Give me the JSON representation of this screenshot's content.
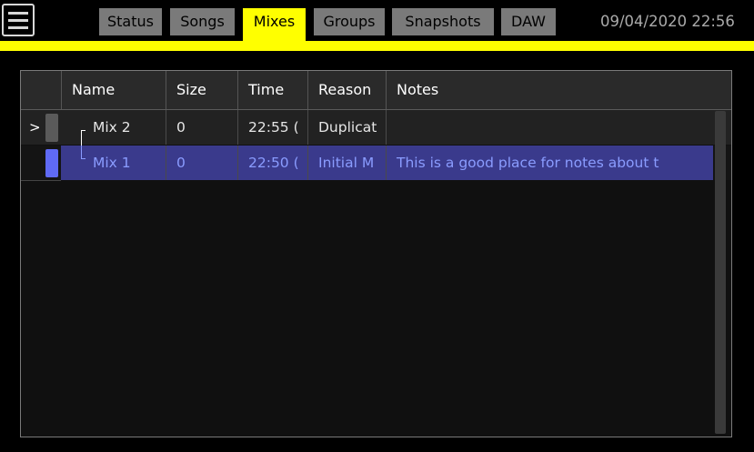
{
  "tabs": [
    {
      "label": "Status"
    },
    {
      "label": "Songs"
    },
    {
      "label": "Mixes"
    },
    {
      "label": "Groups"
    },
    {
      "label": "Snapshots"
    },
    {
      "label": "DAW"
    }
  ],
  "active_tab": "Mixes",
  "datetime": "09/04/2020 22:56",
  "table": {
    "columns": [
      "Name",
      "Size",
      "Time",
      "Reason",
      "Notes"
    ],
    "rows": [
      {
        "marker": ">",
        "name": "Mix 2",
        "size": "0",
        "time": "22:55 (",
        "reason": "Duplicat",
        "notes": ""
      },
      {
        "marker": "",
        "name": "Mix 1",
        "size": "0",
        "time": "22:50 (",
        "reason": "Initial M",
        "notes": "This is a good place for notes about t"
      }
    ]
  },
  "colors": {
    "accent": "#ffff00",
    "tab_bg": "#7a7a7a",
    "selection_bg": "#3a3a8c",
    "selection_text": "#8a9cff"
  }
}
